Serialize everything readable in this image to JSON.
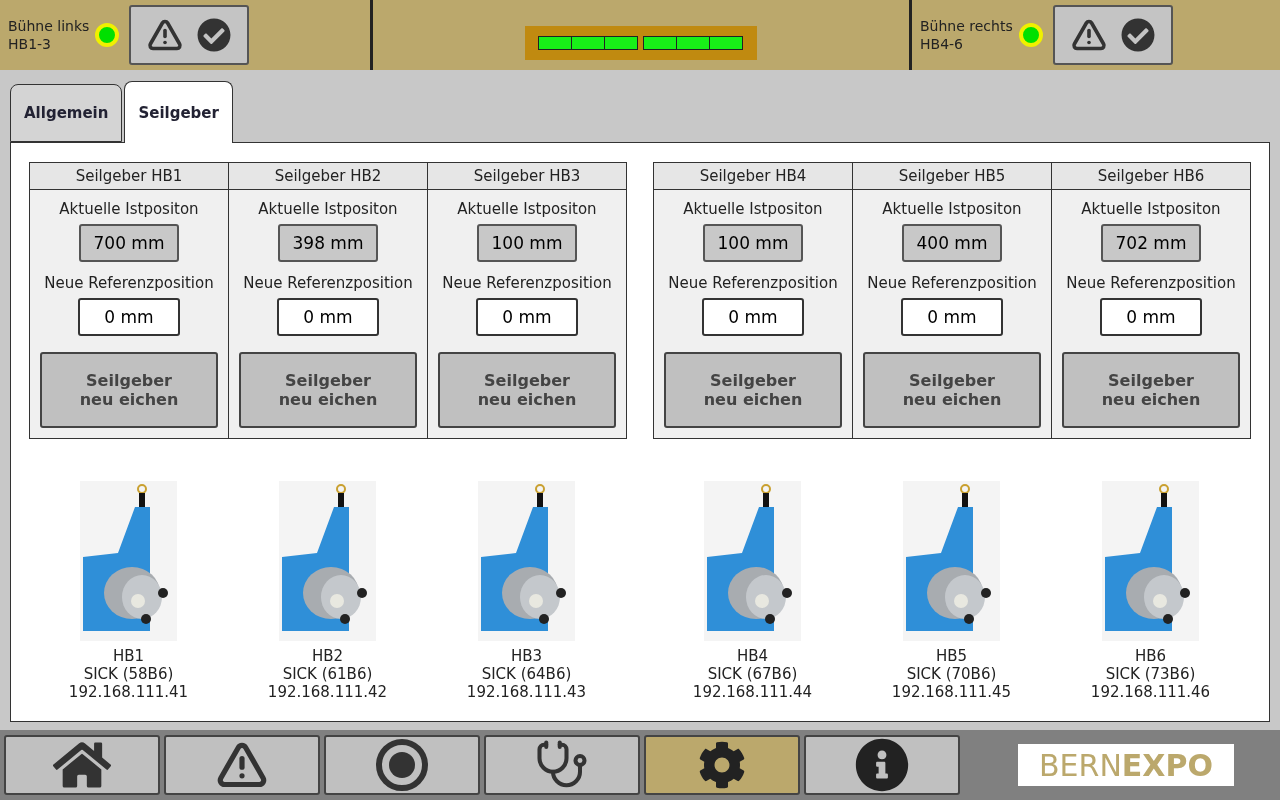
{
  "header": {
    "left": {
      "label": "Bühne links",
      "range": "HB1-3",
      "lamp_on": true,
      "ok": true
    },
    "meter": {
      "segments": [
        {
          "on": true
        },
        {
          "on": true
        },
        {
          "on": true
        },
        {
          "on": true
        },
        {
          "on": true
        },
        {
          "on": true
        }
      ]
    },
    "right": {
      "label": "Bühne rechts",
      "range": "HB4-6",
      "lamp_on": true,
      "ok": true
    }
  },
  "tabs": [
    {
      "label": "Allgemein",
      "selected": false
    },
    {
      "label": "Seilgeber",
      "selected": true
    }
  ],
  "tables": [
    {
      "columns": [
        {
          "title": "Seilgeber HB1",
          "current_label": "Aktuelle Istpositon",
          "current_value": "700 mm",
          "ref_label": "Neue Referenzposition",
          "ref_value": "0 mm",
          "button": "Seilgeber\nneu eichen"
        },
        {
          "title": "Seilgeber HB2",
          "current_label": "Aktuelle Istpositon",
          "current_value": "398 mm",
          "ref_label": "Neue Referenzposition",
          "ref_value": "0 mm",
          "button": "Seilgeber\nneu eichen"
        },
        {
          "title": "Seilgeber HB3",
          "current_label": "Aktuelle Istpositon",
          "current_value": "100 mm",
          "ref_label": "Neue Referenzposition",
          "ref_value": "0 mm",
          "button": "Seilgeber\nneu eichen"
        }
      ]
    },
    {
      "columns": [
        {
          "title": "Seilgeber HB4",
          "current_label": "Aktuelle Istpositon",
          "current_value": "100 mm",
          "ref_label": "Neue Referenzposition",
          "ref_value": "0 mm",
          "button": "Seilgeber\nneu eichen"
        },
        {
          "title": "Seilgeber HB5",
          "current_label": "Aktuelle Istpositon",
          "current_value": "400 mm",
          "ref_label": "Neue Referenzposition",
          "ref_value": "0 mm",
          "button": "Seilgeber\nneu eichen"
        },
        {
          "title": "Seilgeber HB6",
          "current_label": "Aktuelle Istpositon",
          "current_value": "702 mm",
          "ref_label": "Neue Referenzposition",
          "ref_value": "0 mm",
          "button": "Seilgeber\nneu eichen"
        }
      ]
    }
  ],
  "device_groups": [
    {
      "devices": [
        {
          "name": "HB1",
          "model": "SICK (58B6)",
          "ip": "192.168.111.41"
        },
        {
          "name": "HB2",
          "model": "SICK (61B6)",
          "ip": "192.168.111.42"
        },
        {
          "name": "HB3",
          "model": "SICK (64B6)",
          "ip": "192.168.111.43"
        }
      ]
    },
    {
      "devices": [
        {
          "name": "HB4",
          "model": "SICK (67B6)",
          "ip": "192.168.111.44"
        },
        {
          "name": "HB5",
          "model": "SICK (70B6)",
          "ip": "192.168.111.45"
        },
        {
          "name": "HB6",
          "model": "SICK (73B6)",
          "ip": "192.168.111.46"
        }
      ]
    }
  ],
  "nav": [
    {
      "kind": "home",
      "selected": false
    },
    {
      "kind": "alarm",
      "selected": false
    },
    {
      "kind": "record",
      "selected": false
    },
    {
      "kind": "diagnosis",
      "selected": false
    },
    {
      "kind": "settings",
      "selected": true
    },
    {
      "kind": "info",
      "selected": false
    }
  ],
  "logo": "BERN**EXPO**"
}
